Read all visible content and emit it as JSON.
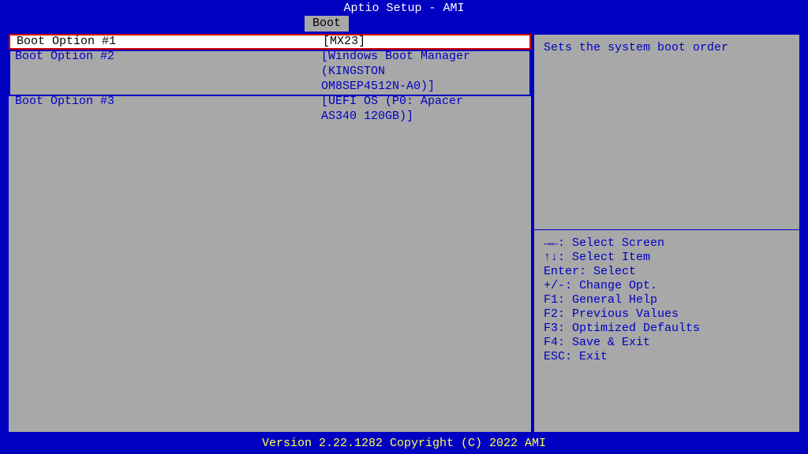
{
  "header": {
    "title": "Aptio Setup - AMI"
  },
  "tab": {
    "label": "Boot"
  },
  "boot_options": [
    {
      "label": "Boot Option #1",
      "value": "[MX23]",
      "selected": true
    },
    {
      "label": "Boot Option #2",
      "value": "[Windows Boot Manager",
      "cont": [
        "(KINGSTON",
        "OM8SEP4512N-A0)]"
      ]
    },
    {
      "label": "Boot Option #3",
      "value": "[UEFI OS (P0: Apacer",
      "cont": [
        "AS340 120GB)]"
      ]
    }
  ],
  "help": {
    "text": "Sets the system boot order"
  },
  "nav": {
    "l1": "→←: Select Screen",
    "l2": "↑↓: Select Item",
    "l3": "Enter: Select",
    "l4": "+/-: Change Opt.",
    "l5": "F1: General Help",
    "l6": "F2: Previous Values",
    "l7": "F3: Optimized Defaults",
    "l8": "F4: Save & Exit",
    "l9": "ESC: Exit"
  },
  "footer": {
    "text": "Version 2.22.1282 Copyright (C) 2022 AMI"
  }
}
